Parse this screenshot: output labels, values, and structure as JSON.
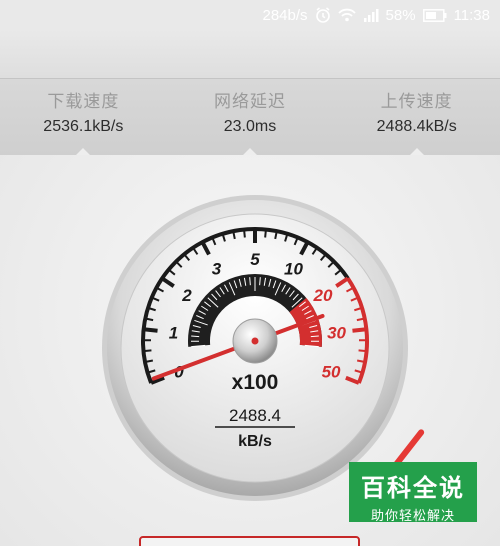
{
  "status_bar": {
    "speed": "284b/s",
    "battery": "58%",
    "time": "11:38"
  },
  "stats": [
    {
      "label": "下载速度",
      "value": "2536.1kB/s"
    },
    {
      "label": "网络延迟",
      "value": "23.0ms"
    },
    {
      "label": "上传速度",
      "value": "2488.4kB/s"
    }
  ],
  "gauge": {
    "scale_labels": [
      "0",
      "1",
      "2",
      "3",
      "5",
      "10",
      "20",
      "30",
      "50"
    ],
    "multiplier": "x100",
    "reading": "2488.4",
    "unit": "kB/s",
    "needle_value": 24.884,
    "colors": {
      "black": "#1a1a1a",
      "red": "#d32f2f"
    }
  },
  "watermark": {
    "title": "百科全说",
    "subtitle": "助你轻松解决"
  }
}
